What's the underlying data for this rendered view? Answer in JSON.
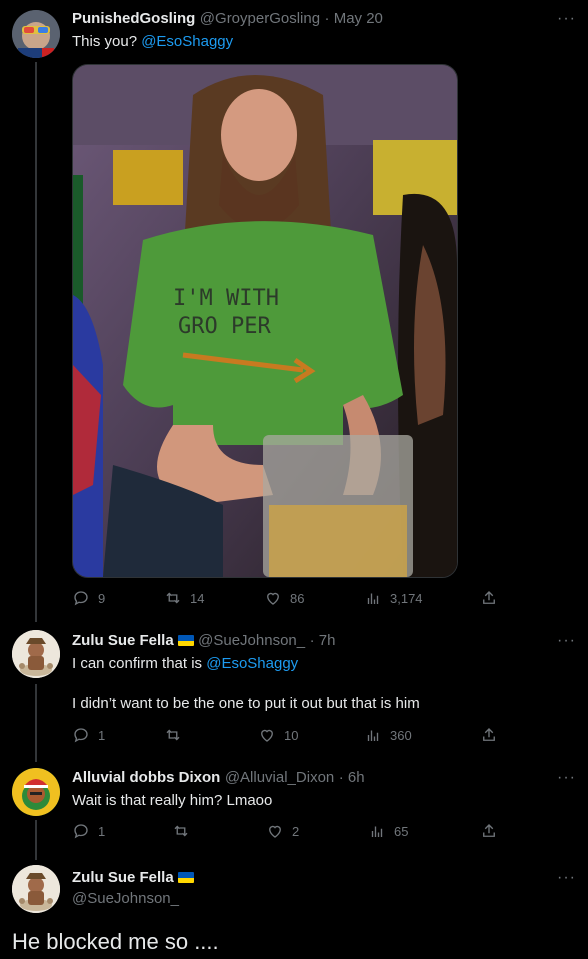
{
  "colors": {
    "accent": "#1d9bf0",
    "muted": "#71767b",
    "text": "#e7e9ea",
    "bg": "#000000",
    "flag_blue": "#0057b7",
    "flag_yellow": "#ffd700"
  },
  "tweets": [
    {
      "author": "PunishedGosling",
      "handle": "@GroyperGosling",
      "time": "· May 20",
      "text_prefix": "This you? ",
      "mention": "@EsoShaggy",
      "media": {
        "shirt_line1": "I'M WITH",
        "shirt_line2": "GRO PER"
      },
      "stats": {
        "replies": "9",
        "retweets": "14",
        "likes": "86",
        "views": "3,174"
      }
    },
    {
      "author": "Zulu Sue Fella",
      "handle": "@SueJohnson_",
      "time": "· 7h",
      "text_prefix": "I can confirm that is ",
      "mention": "@EsoShaggy",
      "text_line2": "I didn’t want to be the one to put it out but that is him",
      "stats": {
        "replies": "1",
        "retweets": "",
        "likes": "10",
        "views": "360"
      }
    },
    {
      "author": "Alluvial dobbs Dixon",
      "handle": "@Alluvial_Dixon",
      "time": "· 6h",
      "text": "Wait is that really him? Lmaoo",
      "stats": {
        "replies": "1",
        "retweets": "",
        "likes": "2",
        "views": "65"
      }
    },
    {
      "author": "Zulu Sue Fella",
      "handle": "@SueJohnson_",
      "text": "He blocked me so ...."
    }
  ],
  "icons": {
    "reply": "reply-icon",
    "retweet": "retweet-icon",
    "like": "heart-icon",
    "views": "views-icon",
    "share": "share-icon",
    "more": "more-icon"
  },
  "more_label": "···"
}
